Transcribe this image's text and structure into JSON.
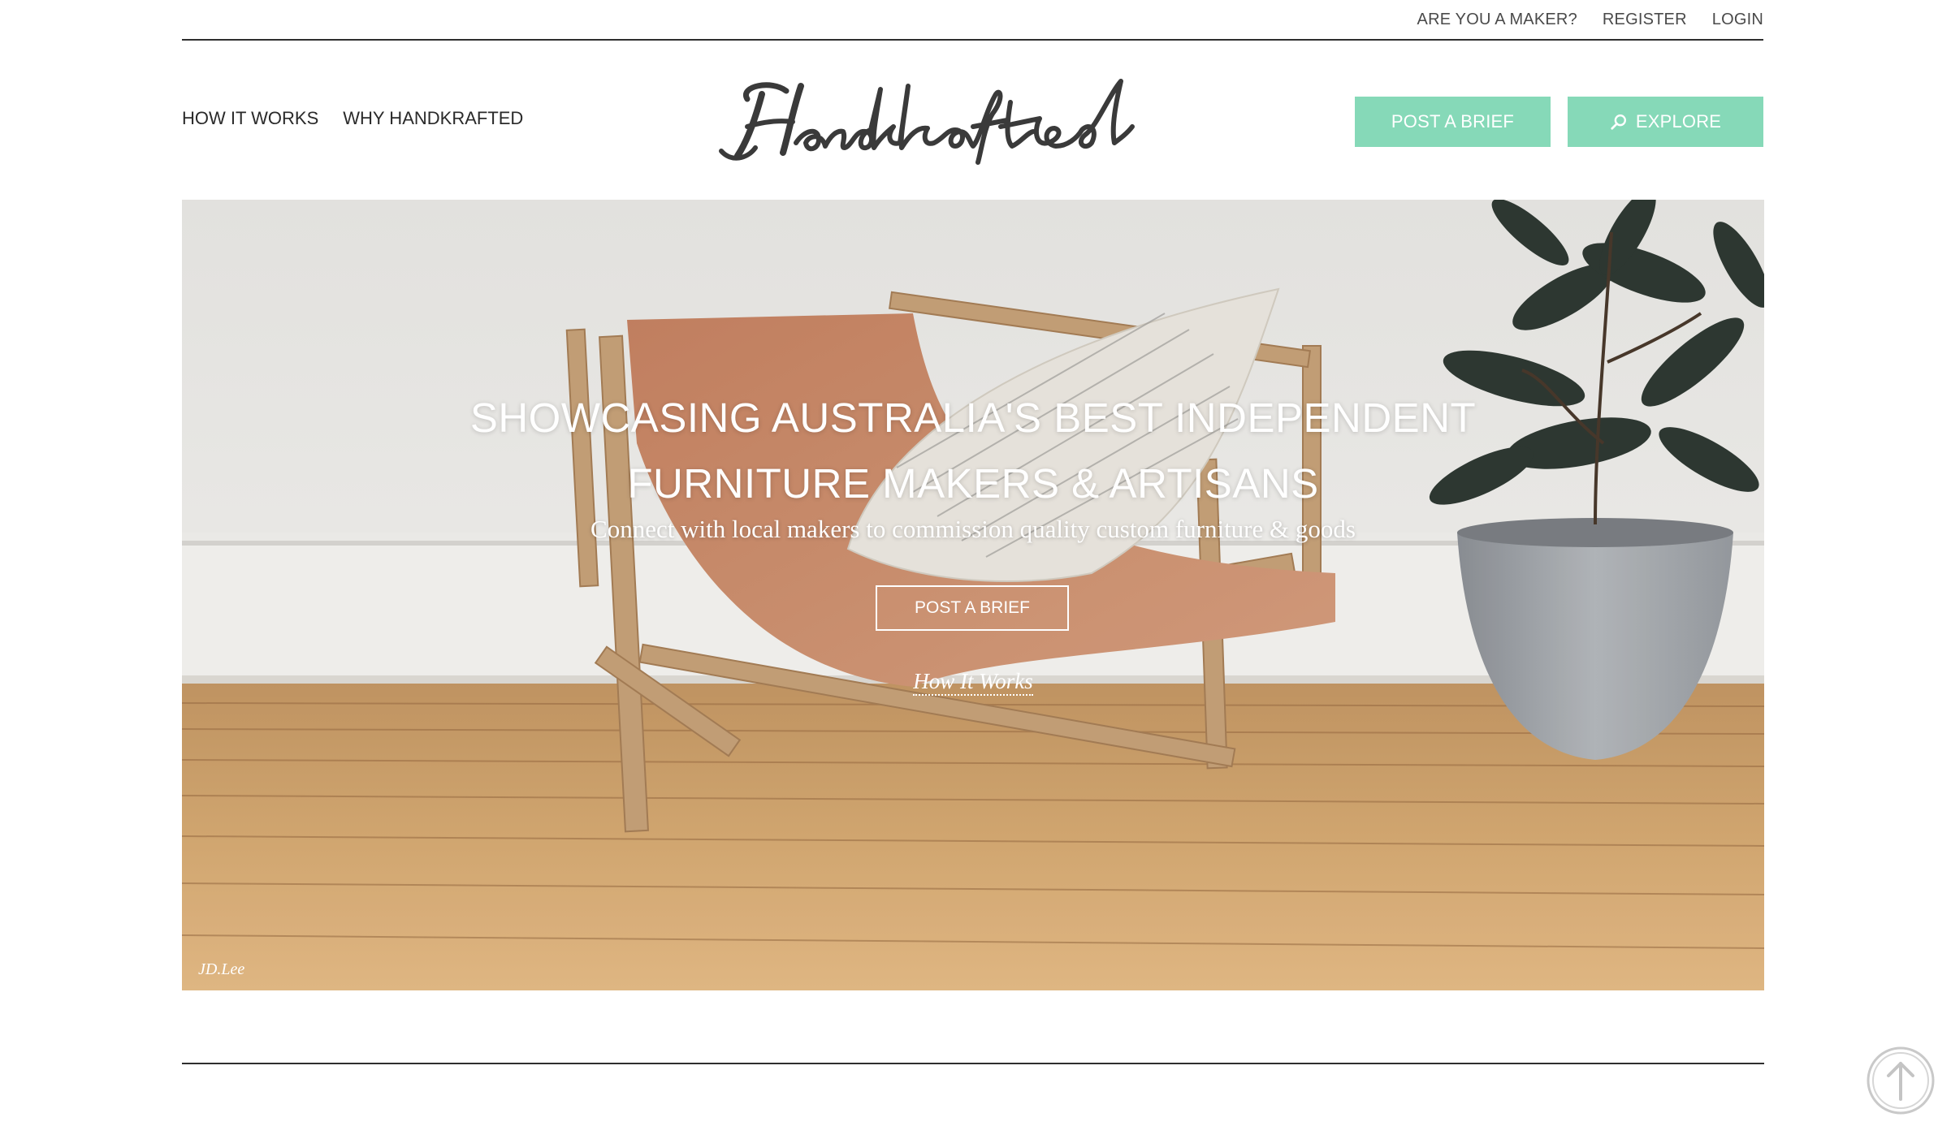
{
  "utility_nav": {
    "maker": "ARE YOU A MAKER?",
    "register": "REGISTER",
    "login": "LOGIN"
  },
  "main_nav": {
    "how_it_works": "HOW IT WORKS",
    "why": "WHY HANDKRAFTED"
  },
  "logo": {
    "text": "Handkrafted"
  },
  "header_buttons": {
    "post_brief": "POST A BRIEF",
    "explore": "EXPLORE",
    "explore_icon": "search-icon"
  },
  "hero": {
    "title_line1": "SHOWCASING AUSTRALIA'S BEST INDEPENDENT",
    "title_line2": "FURNITURE MAKERS & ARTISANS",
    "subtitle": "Connect with local makers to commission quality custom furniture & goods",
    "cta": "POST A BRIEF",
    "link": "How It Works",
    "credit": "JD.Lee"
  },
  "scroll_top": {
    "icon": "arrow-up-circle-icon"
  },
  "colors": {
    "accent": "#86d9b8",
    "text": "#333333",
    "rule": "#2e2e2e"
  }
}
